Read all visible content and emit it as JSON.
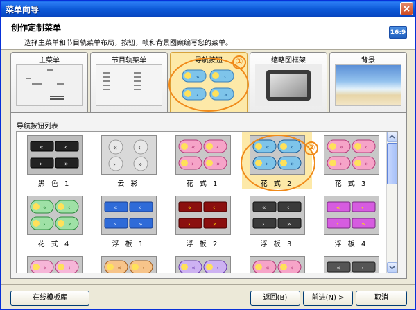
{
  "window": {
    "title": "菜单向导"
  },
  "header": {
    "title": "创作定制菜单",
    "description": "选择主菜单和节目轨菜单布局，按钮，帧和背景图案编写您的菜单。",
    "aspect_badge": "16:9"
  },
  "tabs": [
    {
      "label": "主菜单",
      "active": false
    },
    {
      "label": "节目轨菜单",
      "active": false
    },
    {
      "label": "导航按钮",
      "active": true
    },
    {
      "label": "缩略图框架",
      "active": false
    },
    {
      "label": "背景",
      "active": false
    }
  ],
  "annotations": {
    "marker1": "①",
    "marker2": "②"
  },
  "panel": {
    "title": "导航按钮列表",
    "items": [
      {
        "label": "黑 色 1",
        "style": "black",
        "selected": false
      },
      {
        "label": "云 彩",
        "style": "cloud",
        "selected": false
      },
      {
        "label": "花 式 1",
        "style": "fancy1",
        "selected": false
      },
      {
        "label": "花 式 2",
        "style": "fancy2",
        "selected": true
      },
      {
        "label": "花 式 3",
        "style": "fancy3",
        "selected": false
      },
      {
        "label": "花 式 4",
        "style": "fancy4",
        "selected": false
      },
      {
        "label": "浮 板 1",
        "style": "float1",
        "selected": false
      },
      {
        "label": "浮 板 2",
        "style": "float2",
        "selected": false
      },
      {
        "label": "浮 板 3",
        "style": "float3",
        "selected": false
      },
      {
        "label": "浮 板 4",
        "style": "float4",
        "selected": false
      },
      {
        "label": "",
        "style": "pink",
        "selected": false
      },
      {
        "label": "",
        "style": "peach",
        "selected": false
      },
      {
        "label": "",
        "style": "lilac",
        "selected": false
      },
      {
        "label": "",
        "style": "rose",
        "selected": false
      },
      {
        "label": "",
        "style": "dark",
        "selected": false
      }
    ]
  },
  "footer": {
    "online_templates": "在线模板库",
    "back": "返回(B)",
    "next": "前进(N) >",
    "cancel": "取消"
  },
  "colors": {
    "title_bar": "#0a5fe6",
    "accent_orange": "#f08a1a",
    "selected_bg": "#fde9a8"
  }
}
